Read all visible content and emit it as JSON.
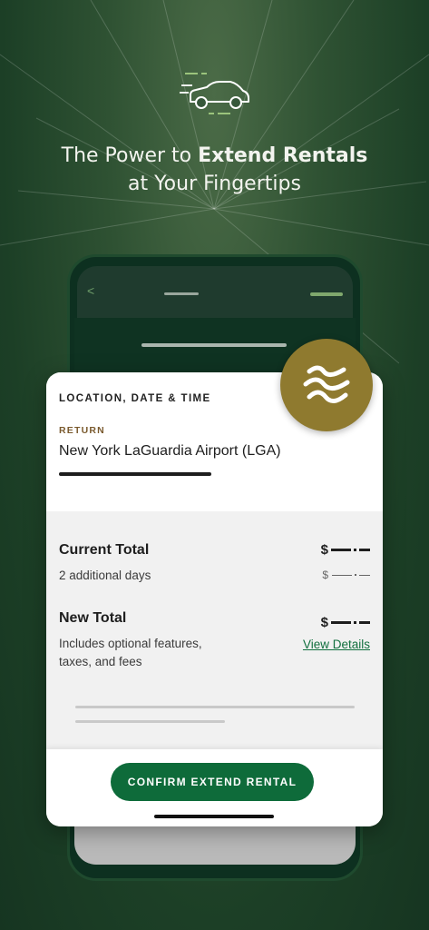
{
  "hero": {
    "icon": "car-icon",
    "headline_prefix": "The Power to ",
    "headline_bold": "Extend Rentals",
    "headline_line2": "at Your Fingertips"
  },
  "phone": {
    "back_icon": "chevron-left-icon",
    "back_glyph": "<"
  },
  "badge": {
    "icon": "wave-logo-icon"
  },
  "card": {
    "section_title": "LOCATION, DATE & TIME",
    "return_label": "RETURN",
    "return_location": "New York LaGuardia Airport (LGA)",
    "current_total": {
      "label": "Current Total",
      "subtext": "2 additional days",
      "currency_symbol": "$",
      "sub_currency_symbol": "$"
    },
    "new_total": {
      "label": "New Total",
      "subtext_line1": "Includes optional features,",
      "subtext_line2": "taxes, and fees",
      "currency_symbol": "$",
      "details_link": "View Details"
    },
    "confirm_button": "CONFIRM EXTEND RENTAL"
  },
  "colors": {
    "background": "#2f5233",
    "accent_green": "#0e6b3a",
    "gold": "#8f7a2f",
    "label_brown": "#7a5a2e"
  }
}
